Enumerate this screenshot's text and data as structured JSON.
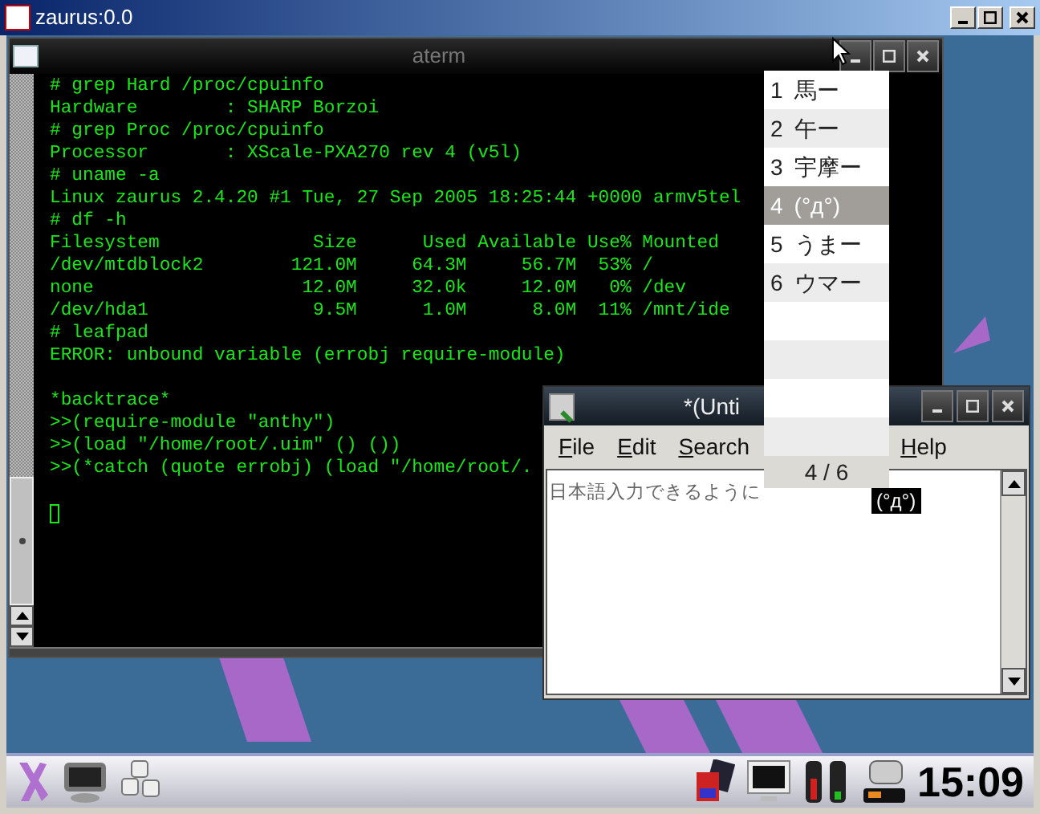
{
  "vnc_window": {
    "title": "zaurus:0.0"
  },
  "terminal": {
    "title": "aterm",
    "blocks": [
      [
        "# grep Hard /proc/cpuinfo",
        "Hardware        : SHARP Borzoi",
        "# grep Proc /proc/cpuinfo",
        "Processor       : XScale-PXA270 rev 4 (v5l)",
        "# uname -a",
        "Linux zaurus 2.4.20 #1 Tue, 27 Sep 2005 18:25:44 +0000 armv5tel",
        "# df -h",
        "Filesystem              Size      Used Available Use% Mounted",
        "/dev/mtdblock2        121.0M     64.3M     56.7M  53% /",
        "none                   12.0M     32.0k     12.0M   0% /dev",
        "/dev/hda1               9.5M      1.0M      8.0M  11% /mnt/ide",
        "# leafpad",
        "ERROR: unbound variable (errobj require-module)"
      ],
      [
        "*backtrace*",
        ">>(require-module \"anthy\")",
        ">>(load \"/home/root/.uim\" () ())",
        ">>(*catch (quote errobj) (load \"/home/root/."
      ]
    ]
  },
  "candidates": {
    "items": [
      {
        "number": "1",
        "text": "馬ー",
        "selected": false
      },
      {
        "number": "2",
        "text": "午ー",
        "selected": false
      },
      {
        "number": "3",
        "text": "宇摩ー",
        "selected": false
      },
      {
        "number": "4",
        "text": "(°д°)",
        "selected": true
      },
      {
        "number": "5",
        "text": "うまー",
        "selected": false
      },
      {
        "number": "6",
        "text": "ウマー",
        "selected": false
      }
    ],
    "counter": "4 / 6"
  },
  "editor": {
    "title": "*(Unti",
    "menu": [
      "File",
      "Edit",
      "Search",
      "Help"
    ],
    "text": "日本語入力できるように",
    "preedit": "(°д°)"
  },
  "taskbar": {
    "clock": "15:09"
  }
}
